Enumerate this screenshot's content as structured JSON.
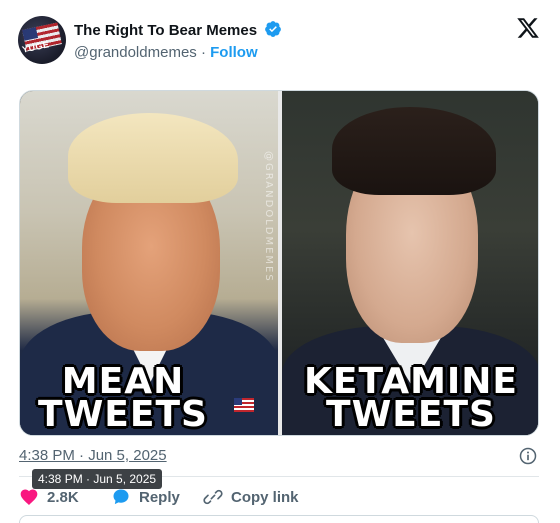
{
  "author": {
    "display_name": "The Right To Bear Memes",
    "handle": "@grandoldmemes",
    "separator": "·",
    "follow_label": "Follow",
    "avatar_text": "YUGE",
    "verified_color": "#1d9bf0"
  },
  "media": {
    "watermark": "@GRANDOLDMEMES",
    "left_caption": [
      "MEAN",
      "TWEETS"
    ],
    "right_caption": [
      "KETAMINE",
      "TWEETS"
    ]
  },
  "meta": {
    "timestamp": "4:38 PM · Jun 5, 2025",
    "tooltip": "4:38 PM · Jun 5, 2025"
  },
  "actions": {
    "likes": "2.8K",
    "reply_label": "Reply",
    "copy_label": "Copy link",
    "like_color": "#f91880",
    "reply_color": "#1d9bf0"
  },
  "icons": {
    "brand": "x-logo-icon",
    "verified": "verified-badge-icon",
    "info": "info-icon",
    "like": "heart-icon",
    "reply": "speech-bubble-icon",
    "copy": "link-icon"
  }
}
